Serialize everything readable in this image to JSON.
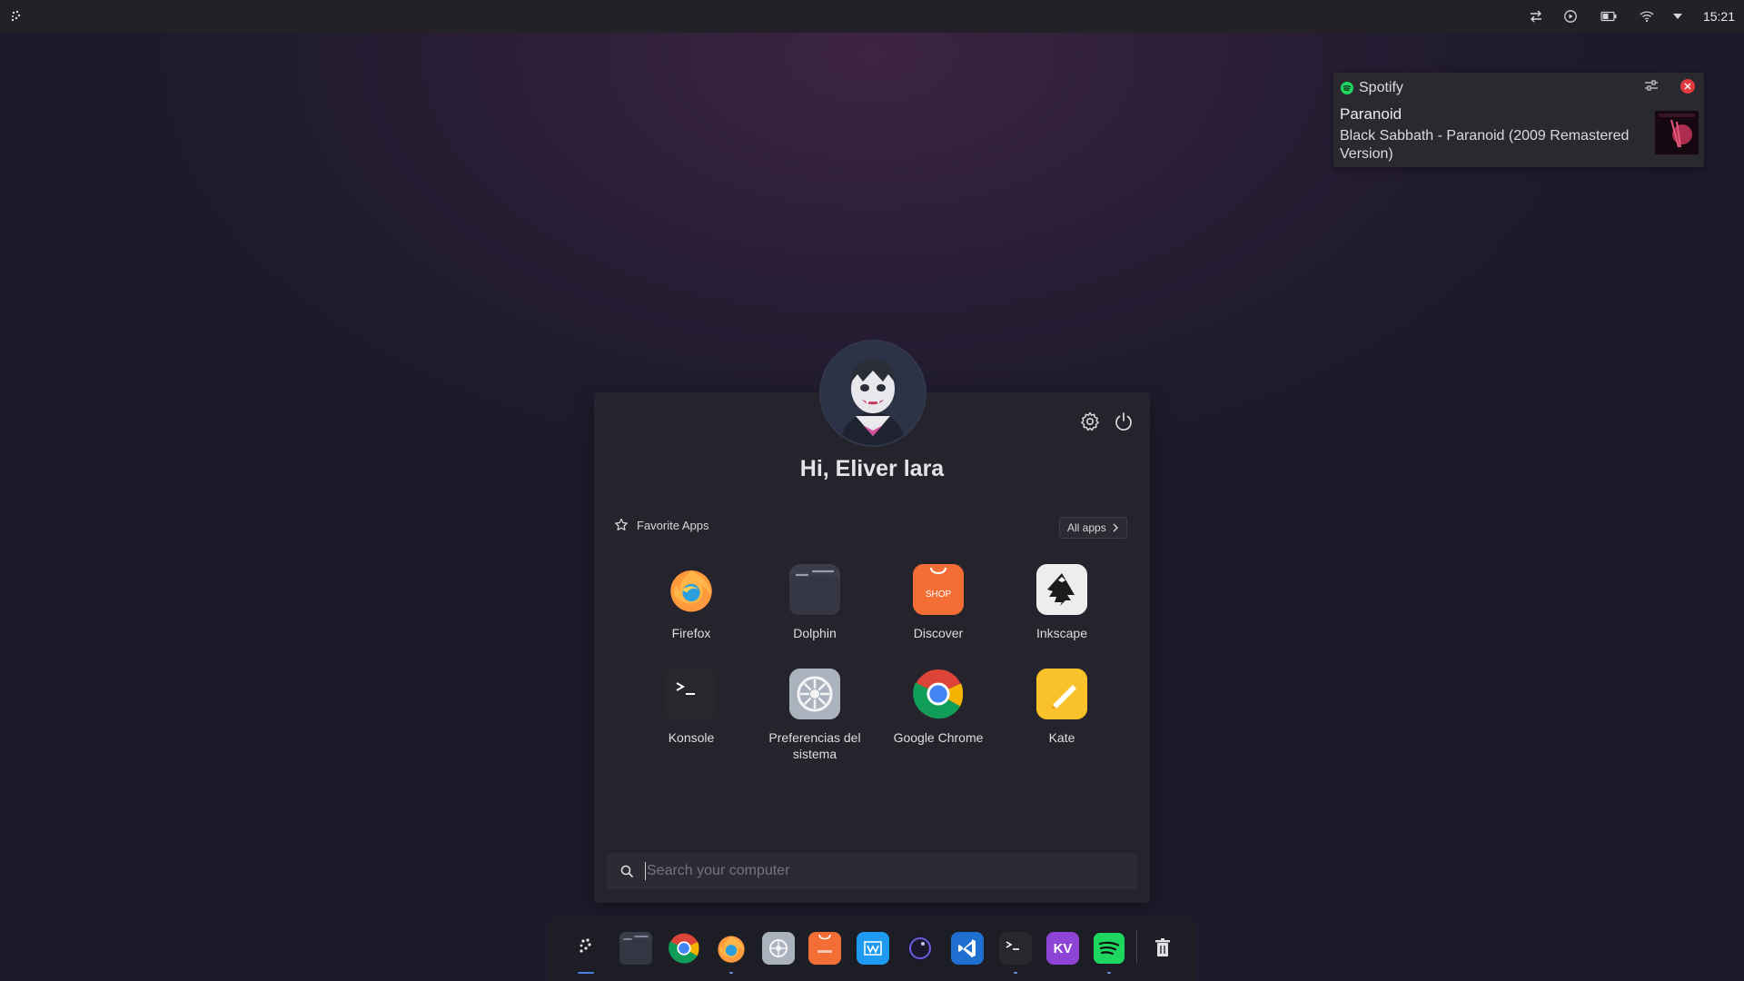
{
  "top_panel": {
    "clock": "15:21",
    "tray_icons": [
      "launcher-icon",
      "transfer-icon",
      "media-icon",
      "battery-icon",
      "wifi-icon",
      "tray-expand-icon"
    ]
  },
  "notification": {
    "app_name": "Spotify",
    "title": "Paranoid",
    "body": "Black Sabbath - Paranoid (2009 Remastered Version)"
  },
  "launcher": {
    "greeting": "Hi, Eliver lara",
    "favorites_label": "Favorite Apps",
    "all_apps_label": "All apps",
    "apps": [
      {
        "name": "Firefox",
        "icon": "firefox-icon"
      },
      {
        "name": "Dolphin",
        "icon": "dolphin-icon"
      },
      {
        "name": "Discover",
        "icon": "discover-icon"
      },
      {
        "name": "Inkscape",
        "icon": "inkscape-icon"
      },
      {
        "name": "Konsole",
        "icon": "konsole-icon"
      },
      {
        "name": "Preferencias del sistema",
        "icon": "system-settings-icon"
      },
      {
        "name": "Google Chrome",
        "icon": "chrome-icon"
      },
      {
        "name": "Kate",
        "icon": "kate-icon"
      }
    ],
    "search": {
      "placeholder": "Search your computer",
      "value": ""
    },
    "discover_icon_text": "SHOP"
  },
  "dock": {
    "items": [
      "launcher-icon",
      "dolphin-icon",
      "chrome-icon",
      "firefox-icon",
      "system-settings-icon",
      "discover-icon",
      "writer-icon",
      "obs-icon",
      "vscode-icon",
      "konsole-icon",
      "kvantum-icon",
      "spotify-icon",
      "trash-icon"
    ],
    "kvantum_text": "KV"
  },
  "colors": {
    "accent": "#4d7fe0",
    "notification_close": "#e03a3e",
    "spotify_green": "#1ed760"
  }
}
